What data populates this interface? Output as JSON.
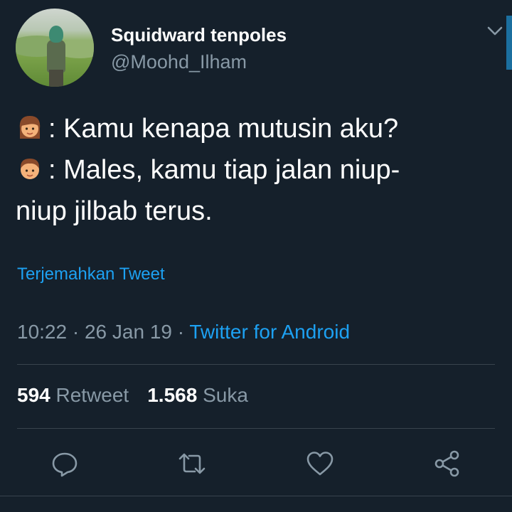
{
  "user": {
    "display_name": "Squidward tenpoles",
    "handle": "@Moohd_Ilham"
  },
  "tweet": {
    "lines": [
      {
        "emoji": "woman-emoji",
        "text": ": Kamu kenapa mutusin aku?"
      },
      {
        "emoji": "boy-emoji",
        "text": ": Males, kamu tiap jalan niup-"
      },
      {
        "emoji": "",
        "text": "niup jilbab terus."
      }
    ]
  },
  "translate_label": "Terjemahkan Tweet",
  "meta": {
    "time": "10:22",
    "sep1": " · ",
    "date": "26 Jan 19",
    "sep2": " · ",
    "source": "Twitter for Android"
  },
  "stats": {
    "retweets": "594",
    "retweets_label": " Retweet",
    "likes": "1.568",
    "likes_label": " Suka"
  },
  "actions": [
    "reply-icon",
    "retweet-icon",
    "like-icon",
    "share-icon"
  ],
  "colors": {
    "background": "#15202b",
    "accent": "#1da1f2",
    "muted": "#8899a6",
    "divider": "#38444d"
  }
}
